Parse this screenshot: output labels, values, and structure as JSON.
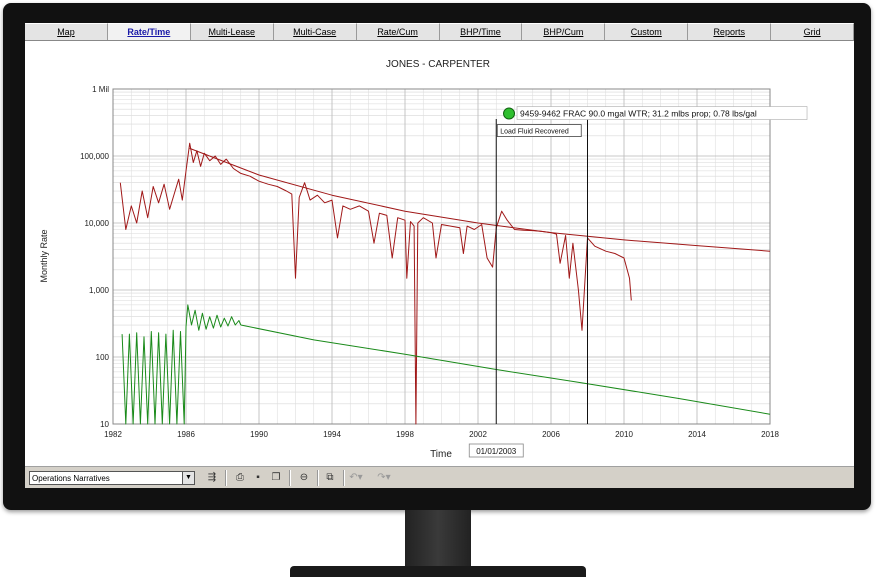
{
  "tabs": [
    {
      "label": "Map",
      "active": false
    },
    {
      "label": "Rate/Time",
      "active": true
    },
    {
      "label": "Multi-Lease",
      "active": false
    },
    {
      "label": "Multi-Case",
      "active": false
    },
    {
      "label": "Rate/Cum",
      "active": false
    },
    {
      "label": "BHP/Time",
      "active": false
    },
    {
      "label": "BHP/Cum",
      "active": false
    },
    {
      "label": "Custom",
      "active": false
    },
    {
      "label": "Reports",
      "active": false
    },
    {
      "label": "Grid",
      "active": false
    }
  ],
  "toolbar": {
    "narratives_value": "Operations Narratives",
    "icons": [
      "narrative-flow-icon",
      "print-icon",
      "save-icon",
      "copy-icon",
      "zoom-out-icon",
      "duplicate-icon",
      "undo-icon",
      "redo-icon"
    ]
  },
  "chart_data": {
    "type": "line",
    "title": "JONES - CARPENTER",
    "xlabel": "Time",
    "ylabel": "Monthly Rate",
    "xlim": [
      1982,
      2018
    ],
    "ylim": [
      10,
      1000000
    ],
    "yscale": "log",
    "x_ticks": [
      "1982",
      "1986",
      "1990",
      "1994",
      "1998",
      "2002",
      "2006",
      "2010",
      "2014",
      "2018"
    ],
    "y_ticks": [
      "10",
      "100",
      "1,000",
      "10,000",
      "100,000",
      "1 Mil"
    ],
    "grid": true,
    "series": [
      {
        "color": "#a01818",
        "values": [
          [
            1982.4,
            40000
          ],
          [
            1982.7,
            8000
          ],
          [
            1983.0,
            18000
          ],
          [
            1983.3,
            10000
          ],
          [
            1983.6,
            30000
          ],
          [
            1983.9,
            12000
          ],
          [
            1984.2,
            35000
          ],
          [
            1984.5,
            20000
          ],
          [
            1984.8,
            38000
          ],
          [
            1985.1,
            16000
          ],
          [
            1985.4,
            30000
          ],
          [
            1985.6,
            45000
          ],
          [
            1985.8,
            22000
          ],
          [
            1986.0,
            60000
          ],
          [
            1986.2,
            155000
          ],
          [
            1986.4,
            80000
          ],
          [
            1986.6,
            120000
          ],
          [
            1986.8,
            70000
          ],
          [
            1987.0,
            110000
          ],
          [
            1987.3,
            85000
          ],
          [
            1987.6,
            100000
          ],
          [
            1987.9,
            75000
          ],
          [
            1988.2,
            90000
          ],
          [
            1988.6,
            65000
          ],
          [
            1989.0,
            55000
          ],
          [
            1989.5,
            50000
          ],
          [
            1990.0,
            42000
          ],
          [
            1990.5,
            38000
          ],
          [
            1991.0,
            35000
          ],
          [
            1991.5,
            30000
          ],
          [
            1991.8,
            27000
          ],
          [
            1992.0,
            1500
          ],
          [
            1992.2,
            24000
          ],
          [
            1992.5,
            40000
          ],
          [
            1992.8,
            22000
          ],
          [
            1993.2,
            26000
          ],
          [
            1993.6,
            20000
          ],
          [
            1994.0,
            22000
          ],
          [
            1994.3,
            6000
          ],
          [
            1994.6,
            18000
          ],
          [
            1995.0,
            16000
          ],
          [
            1995.5,
            18000
          ],
          [
            1996.0,
            15000
          ],
          [
            1996.3,
            5000
          ],
          [
            1996.6,
            14000
          ],
          [
            1997.0,
            13000
          ],
          [
            1997.3,
            3000
          ],
          [
            1997.6,
            12000
          ],
          [
            1998.0,
            11000
          ],
          [
            1998.1,
            1500
          ],
          [
            1998.3,
            10500
          ],
          [
            1998.5,
            9000
          ],
          [
            1998.6,
            10
          ],
          [
            1998.7,
            10000
          ],
          [
            1999.0,
            12000
          ],
          [
            1999.5,
            10000
          ],
          [
            1999.7,
            3000
          ],
          [
            2000.0,
            9500
          ],
          [
            2000.5,
            9000
          ],
          [
            2001.0,
            8500
          ],
          [
            2001.2,
            3500
          ],
          [
            2001.4,
            9000
          ],
          [
            2001.8,
            8000
          ],
          [
            2002.2,
            9500
          ],
          [
            2002.5,
            3000
          ],
          [
            2002.8,
            2200
          ],
          [
            2003.0,
            8500
          ],
          [
            2003.3,
            15000
          ],
          [
            2003.6,
            11000
          ],
          [
            2004.0,
            8000
          ],
          [
            2004.5,
            7800
          ],
          [
            2005.0,
            7700
          ],
          [
            2005.5,
            7500
          ],
          [
            2006.0,
            7200
          ],
          [
            2006.3,
            6800
          ],
          [
            2006.5,
            2500
          ],
          [
            2006.8,
            6500
          ],
          [
            2007.0,
            1500
          ],
          [
            2007.2,
            5000
          ],
          [
            2007.5,
            1000
          ],
          [
            2007.7,
            250
          ],
          [
            2008.0,
            6000
          ],
          [
            2008.4,
            4500
          ],
          [
            2009.0,
            3800
          ],
          [
            2009.5,
            3500
          ],
          [
            2010.0,
            3000
          ],
          [
            2010.3,
            1500
          ],
          [
            2010.4,
            700
          ]
        ]
      },
      {
        "color": "#a01818",
        "values": [
          [
            1986.2,
            130000
          ],
          [
            1990.0,
            52000
          ],
          [
            1994.0,
            26000
          ],
          [
            1998.0,
            15000
          ],
          [
            2002.0,
            10000
          ],
          [
            2006.0,
            7200
          ],
          [
            2010.0,
            5600
          ],
          [
            2014.0,
            4600
          ],
          [
            2018.0,
            3800
          ]
        ]
      },
      {
        "color": "#1a8a1a",
        "values": [
          [
            1982.5,
            220
          ],
          [
            1982.7,
            10
          ],
          [
            1982.9,
            220
          ],
          [
            1983.1,
            10
          ],
          [
            1983.3,
            230
          ],
          [
            1983.5,
            10
          ],
          [
            1983.7,
            200
          ],
          [
            1983.9,
            10
          ],
          [
            1984.1,
            240
          ],
          [
            1984.3,
            10
          ],
          [
            1984.5,
            230
          ],
          [
            1984.7,
            10
          ],
          [
            1984.9,
            220
          ],
          [
            1985.1,
            10
          ],
          [
            1985.3,
            250
          ],
          [
            1985.5,
            10
          ],
          [
            1985.7,
            240
          ],
          [
            1985.9,
            10
          ],
          [
            1986.0,
            280
          ],
          [
            1986.1,
            600
          ],
          [
            1986.3,
            300
          ],
          [
            1986.5,
            500
          ],
          [
            1986.7,
            250
          ],
          [
            1986.9,
            450
          ],
          [
            1987.1,
            260
          ],
          [
            1987.3,
            400
          ],
          [
            1987.5,
            270
          ],
          [
            1987.7,
            420
          ],
          [
            1987.9,
            280
          ],
          [
            1988.1,
            380
          ],
          [
            1988.3,
            290
          ],
          [
            1988.5,
            400
          ],
          [
            1988.7,
            300
          ],
          [
            1988.9,
            350
          ],
          [
            1989.0,
            300
          ]
        ]
      },
      {
        "color": "#1a8a1a",
        "values": [
          [
            1989.0,
            300
          ],
          [
            1993.0,
            180
          ],
          [
            1998.0,
            110
          ],
          [
            2003.0,
            65
          ],
          [
            2008.0,
            40
          ],
          [
            2013.0,
            24
          ],
          [
            2018.0,
            14
          ]
        ]
      }
    ],
    "markers": [
      {
        "x": 2003.0,
        "label": "01/01/2003"
      },
      {
        "x": 2008.0,
        "label": ""
      }
    ],
    "annotations": {
      "event": "9459-9462 FRAC 90.0 mgal WTR; 31.2 mlbs prop; 0.78 lbs/gal",
      "event_x": 2003.7,
      "event_y": 430000,
      "note": "Load Fluid Recovered"
    }
  }
}
